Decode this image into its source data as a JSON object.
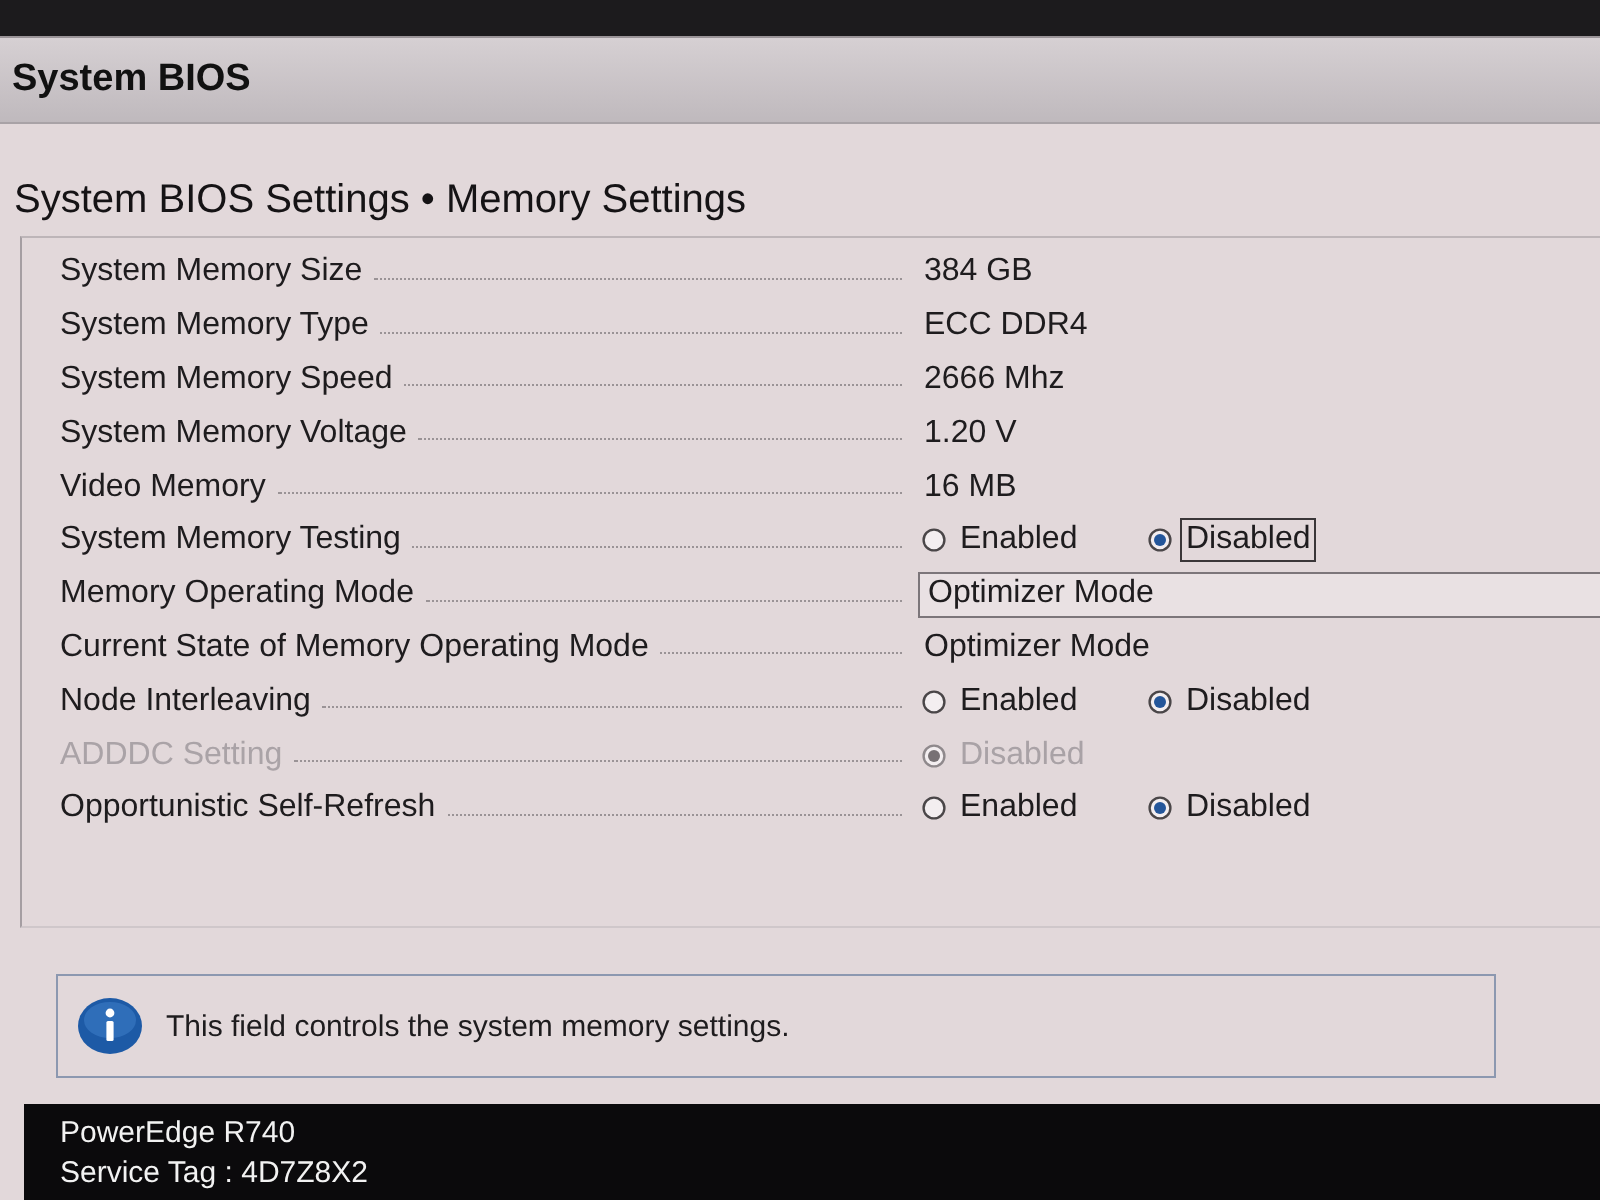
{
  "header": {
    "title": "System BIOS"
  },
  "page_title": "System BIOS Settings • Memory Settings",
  "settings": [
    {
      "kind": "info",
      "label": "System Memory Size",
      "value": "384 GB",
      "disabled": false
    },
    {
      "kind": "info",
      "label": "System Memory Type",
      "value": "ECC DDR4",
      "disabled": false
    },
    {
      "kind": "info",
      "label": "System Memory Speed",
      "value": "2666 Mhz",
      "disabled": false
    },
    {
      "kind": "info",
      "label": "System Memory Voltage",
      "value": "1.20 V",
      "disabled": false
    },
    {
      "kind": "info",
      "label": "Video Memory",
      "value": "16 MB",
      "disabled": false
    },
    {
      "kind": "radio",
      "label": "System Memory Testing",
      "disabled": false,
      "options": [
        {
          "label": "Enabled",
          "selected": false,
          "focused": false
        },
        {
          "label": "Disabled",
          "selected": true,
          "focused": true
        }
      ]
    },
    {
      "kind": "dropdown",
      "label": "Memory Operating Mode",
      "value": "Optimizer Mode",
      "disabled": false
    },
    {
      "kind": "info",
      "label": "Current State of Memory Operating Mode",
      "value": "Optimizer Mode",
      "disabled": false
    },
    {
      "kind": "radio",
      "label": "Node Interleaving",
      "disabled": false,
      "options": [
        {
          "label": "Enabled",
          "selected": false,
          "focused": false
        },
        {
          "label": "Disabled",
          "selected": true,
          "focused": false
        }
      ]
    },
    {
      "kind": "radio",
      "label": "ADDDC Setting",
      "disabled": true,
      "options": [
        {
          "label": "Disabled",
          "selected": true,
          "focused": false
        }
      ]
    },
    {
      "kind": "radio",
      "label": "Opportunistic Self-Refresh",
      "disabled": false,
      "options": [
        {
          "label": "Enabled",
          "selected": false,
          "focused": false
        },
        {
          "label": "Disabled",
          "selected": true,
          "focused": false
        }
      ]
    }
  ],
  "help": {
    "text": "This field controls the system memory settings."
  },
  "footer": {
    "model": "PowerEdge R740",
    "service_tag": "Service Tag : 4D7Z8X2"
  }
}
